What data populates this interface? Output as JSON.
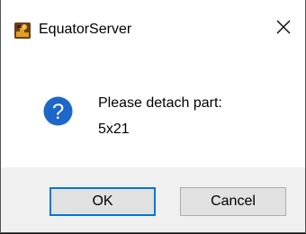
{
  "window": {
    "title": "EquatorServer",
    "app_icon": "equator-app-icon",
    "close_icon": "close-icon"
  },
  "message": {
    "icon": "question-icon",
    "line1": "Please detach part:",
    "line2": "5x21"
  },
  "buttons": {
    "ok_label": "OK",
    "cancel_label": "Cancel"
  },
  "colors": {
    "question_icon": "#1c67c9",
    "default_button_border": "#0078d7",
    "footer_bg": "#f0f0f0",
    "button_bg": "#e1e1e1"
  }
}
